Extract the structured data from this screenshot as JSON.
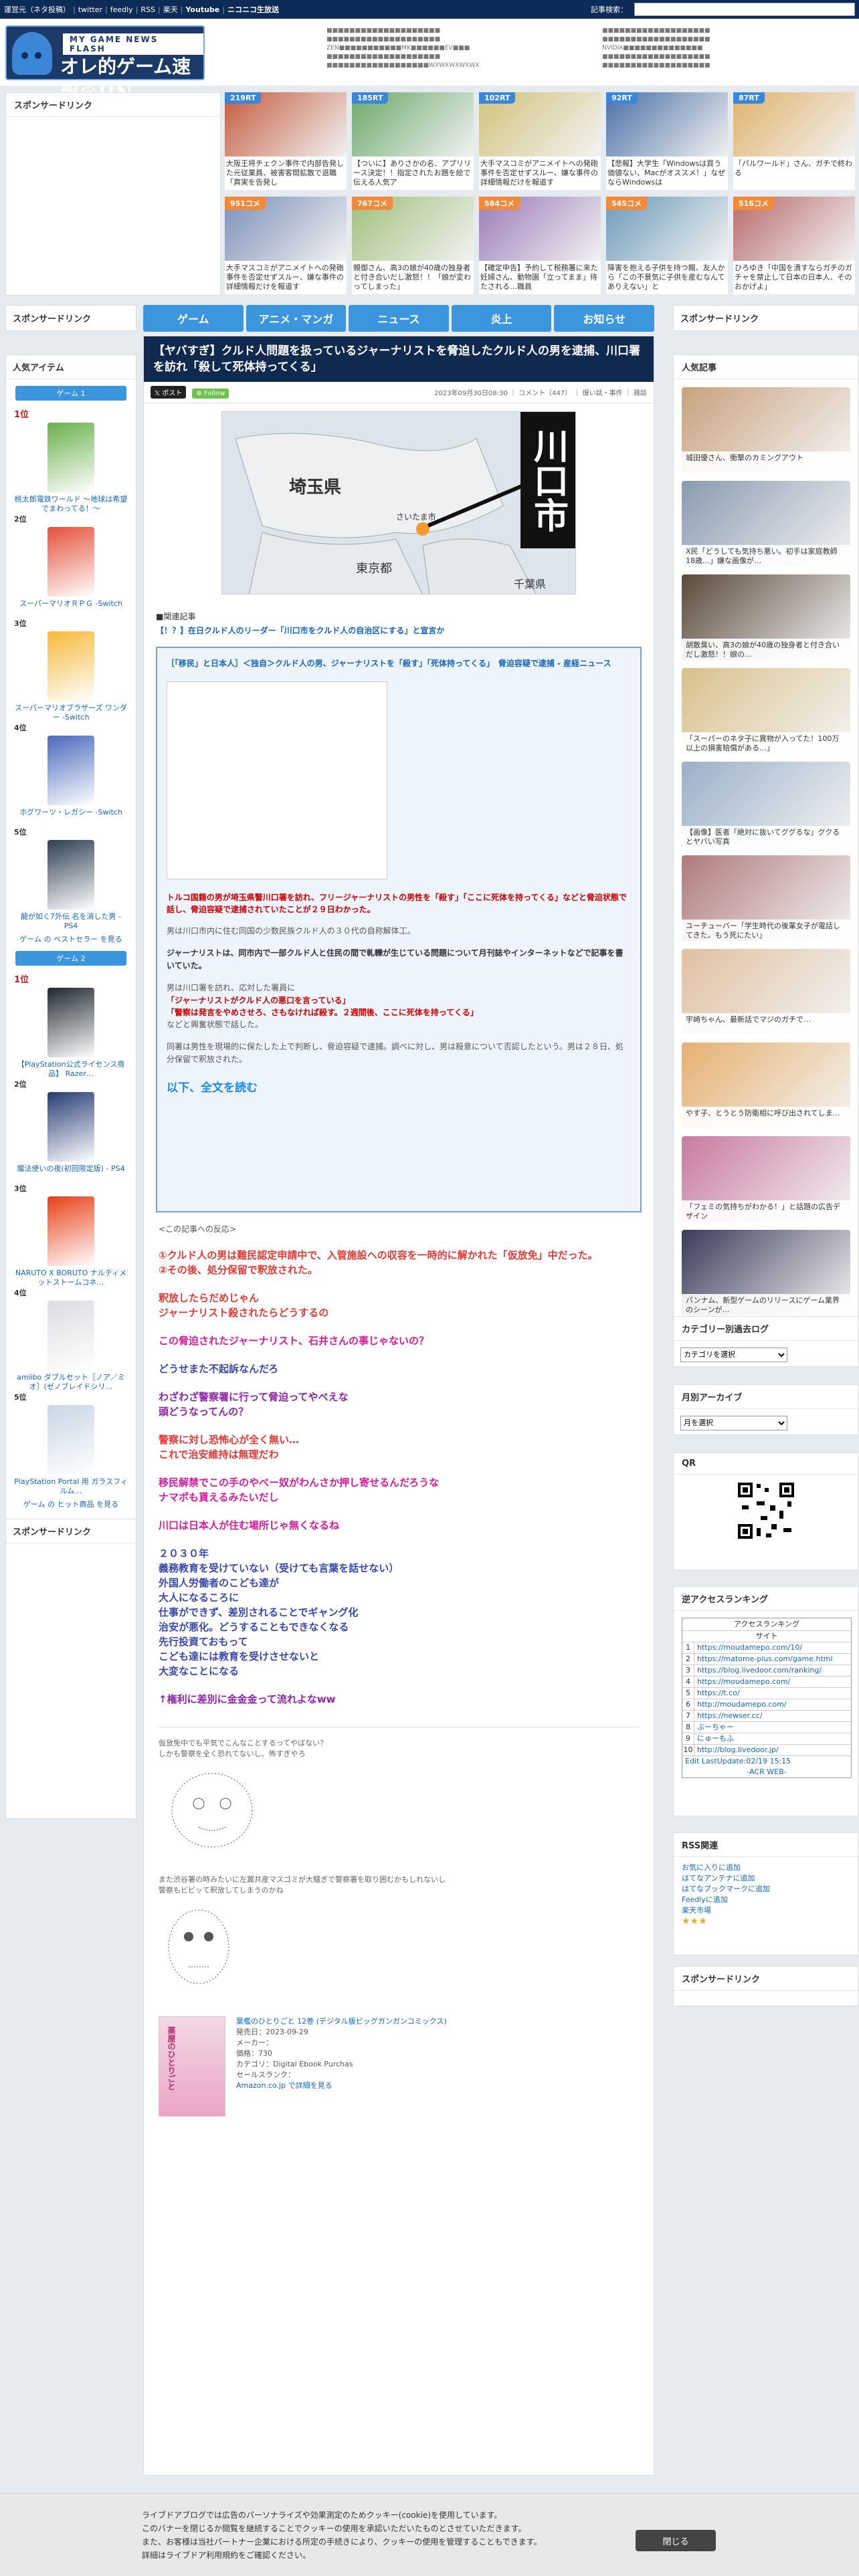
{
  "topbar": {
    "links": [
      "運営元（ネタ投稿）",
      "twitter",
      "feedly",
      "RSS",
      "楽天",
      "Youtube",
      "ニコニコ生放送"
    ],
    "search_label": "記事検索："
  },
  "logo": {
    "small": "MY GAME NEWS FLASH",
    "big": "オレ的ゲーム速報@JIN"
  },
  "header_ads": [
    [
      "■■■■■■■■■■■■■■■■■■■■",
      "■■■■■■■■■■■■■■■■■■■■",
      "ZEN■■■■■■■■■■■MK■■■■■■EV■■■",
      "■■■■■■■■■■■■■■■■■■■■",
      "■■■■■■■■■■■■■■■■■■WXWXWXWXWX"
    ],
    [
      "■■■■■■■■■■■■■■■■■■■",
      "■■■■■■■■■■■■■■■■■■■",
      "NVIDIA■■■■■■■■■■■■■■",
      "■■■■■■■■■■■■■■■■■■■",
      "■■■■■■■■■■■■■■■■■■■"
    ]
  ],
  "sponsor_title": "スポンサードリンク",
  "grid": [
    {
      "badge": "219RT",
      "orange": false,
      "cap": "大阪王将チェクン事件で内部告発した元従業員、被害客間拡散で退職「真実を告発し"
    },
    {
      "badge": "185RT",
      "orange": false,
      "cap": "【ついに】ありさかの名、アプリリース決定！！指定されたお題を絵で伝える人気ア"
    },
    {
      "badge": "102RT",
      "orange": false,
      "cap": "大手マスコミがアニメイトへの発砲事件を否定せずスルー、嫌な事件の詳細情報だけを報道す"
    },
    {
      "badge": "92RT",
      "orange": false,
      "cap": "【悲報】大学生「Windowsは買う価値ない、Macがオススメ！」なぜならWindowsは"
    },
    {
      "badge": "87RT",
      "orange": false,
      "cap": "「パルワールド」さん、ガチで終わる"
    },
    {
      "badge": "951コメ",
      "orange": true,
      "cap": "大手マスコミがアニメイトへの発砲事件を否定せずスルー、嫌な事件の詳細情報だけを報道す"
    },
    {
      "badge": "767コメ",
      "orange": true,
      "cap": "親御さん、高3の娘が40歳の独身者と付き合いだし激怒！！「娘が変わってしまった」"
    },
    {
      "badge": "584コメ",
      "orange": true,
      "cap": "【確定申告】予約して税務署に来た妊婦さん、動物園「立ってまま」待たされる…職員"
    },
    {
      "badge": "545コメ",
      "orange": true,
      "cap": "障害を抱える子供を持つ親、友人から「この不景気に子供を産むなんてありえない」と"
    },
    {
      "badge": "516コメ",
      "orange": true,
      "cap": "ひろゆき「中国を潰すならガチのガチャを禁止して日本の日本人、そのおかげよ」"
    }
  ],
  "nav": [
    "ゲーム",
    "アニメ・マンガ",
    "ニュース",
    "炎上",
    "お知らせ"
  ],
  "left": {
    "sponsor": "スポンサードリンク",
    "popular": "人気アイテム",
    "tab1": "ゲーム 1",
    "tab2": "ゲーム 2",
    "items1": [
      {
        "rank": "1位",
        "name": "桃太郎電鉄ワールド ～地球は希望でまわってる！～"
      },
      {
        "rank": "2位",
        "name": "スーパーマリオＲＰＧ -Switch"
      },
      {
        "rank": "3位",
        "name": "スーパーマリオブラザーズ ワンダー -Switch"
      },
      {
        "rank": "4位",
        "name": "ホグワーツ・レガシー -Switch"
      },
      {
        "rank": "5位",
        "name": "龍が如く7外伝 名を消した男 - PS4"
      }
    ],
    "more1": "ゲーム の ベストセラー を見る",
    "items2": [
      {
        "rank": "1位",
        "name": "【PlayStation公式ライセンス商品】 Razer…"
      },
      {
        "rank": "2位",
        "name": "魔法使いの夜(初回限定版) - PS4"
      },
      {
        "rank": "3位",
        "name": "NARUTO X BORUTO ナルティメットストームコネ…"
      },
      {
        "rank": "4位",
        "name": "amiibo ダブルセット［ノア／ミオ］(ゼノブレイドシリ…"
      },
      {
        "rank": "5位",
        "name": "PlayStation Portal 用 ガラスフィルム…"
      }
    ],
    "more2": "ゲーム の ヒット商品 を見る",
    "sponsor2": "スポンサードリンク"
  },
  "article": {
    "title": "【ヤバすぎ】クルド人問題を扱っているジャーナリストを脅迫したクルド人の男を逮捕、川口署を訪れ「殺して死体持ってくる」",
    "tweet": "ポスト",
    "follow": "Follow",
    "meta": "2023年09月30日08:30 ｜ コメント（447） ｜ 爆い話・事件 ｜ 雑談",
    "map_pref": "埼玉県",
    "map_city": "さいたま市",
    "map_tokyo": "東京都",
    "map_chiba": "千葉県",
    "map_callout": "川口市",
    "related_head": "■関連記事",
    "related_link": "【！？】在日クルド人のリーダー「川口市をクルド人の自治区にする」と宣言か",
    "quote_link": "［「移民」と日本人］＜独自＞クルド人の男、ジャーナリストを「殺す」「死体持ってくる」　脅迫容疑で逮捕 - 産経ニュース",
    "q1": "トルコ国籍の男が埼玉県警川口署を訪れ、フリージャーナリストの男性を「殺す」「ここに死体を持ってくる」などと脅迫状態で話し、脅迫容疑で逮捕されていたことが２９日わかった。",
    "q2": "男は川口市内に住む同国の少数民族クルド人の３０代の自称解体工。",
    "q3": "ジャーナリストは、同市内で一部クルド人と住民の間で軋轢が生じている問題について月刊誌やインターネットなどで記事を書いていた。",
    "q4": "男は川口署を訪れ、応対した署員に",
    "q5": "「ジャーナリストがクルド人の悪口を言っている」",
    "q6": "「警察は発言をやめさせろ、さもなければ殺す。２週間後、ここに死体を持ってくる」",
    "q7": "などと興奮状態で話した。",
    "q8": "同署は男性を現場的に保たした上で判断し、脅迫容疑で逮捕。調べに対し、男は殺意について否認したという。男は２８日、処分保留で釈放された。",
    "more": "以下、全文を読む",
    "react_head": "<この記事への反応>",
    "comments": [
      {
        "cls": "r",
        "text": "①クルド人の男は難民認定申請中で、入管施設への収容を一時的に解かれた「仮放免」中だった。\n②その後、処分保留で釈放された。"
      },
      {
        "cls": "r",
        "text": "釈放したらだめじゃん\nジャーナリスト殺されたらどうするの"
      },
      {
        "cls": "m",
        "text": "この脅迫されたジャーナリスト、石井さんの事じゃないの？"
      },
      {
        "cls": "b",
        "text": "どうせまた不起訴なんだろ"
      },
      {
        "cls": "p",
        "text": "わざわざ警察署に行って脅迫ってやべえな\n頭どうなってんの？"
      },
      {
        "cls": "r",
        "text": "警察に対し恐怖心が全く無い…\nこれで治安維持は無理だわ"
      },
      {
        "cls": "m",
        "text": "移民解禁でこの手のやべー奴がわんさか押し寄せるんだろうな\nナマポも貰えるみたいだし"
      },
      {
        "cls": "m",
        "text": "川口は日本人が住む場所じゃ無くなるね"
      },
      {
        "cls": "b",
        "text": "２０３０年\n義務教育を受けていない（受けても言葉を話せない）\n外国人労働者のこども達が\n大人になるころに\n仕事ができず、差別されることでギャング化\n治安が悪化。どうすることもできなくなる\n先行投資ておもって\nこども達には教育を受けさせないと\n大変なことになる"
      },
      {
        "cls": "p",
        "text": "↑権利に差別に金金金って流れよなww"
      }
    ],
    "aa1": "仮放免中でも平気でこんなことするってやばない？\nしかも警察を全く恐れてないし、怖すぎやろ",
    "aa2": "また渋谷署の時みたいに左翼共産マスゴミが大騒ぎで警察署を取り囲むかもしれないし\n警察もビビッて釈放してしまうのかね",
    "product": {
      "title": "葉檻のひとりごと 12巻 (デジタル版ビッグガンガンコミックス)",
      "lines": [
        "発売日：2023-09-29",
        "メーカー：",
        "価格：730",
        "カテゴリ：Digital Ebook Purchas",
        "セールスランク："
      ],
      "link": "Amazon.co.jp で詳細を見る",
      "cover_text": "薬屋のひとりごと"
    }
  },
  "right": {
    "sponsor": "スポンサードリンク",
    "popular": "人気記事",
    "items": [
      "城田優さん、衝撃のカミングアウト",
      "X民「どうしても気持ち悪い。初手は家庭教師18歳…」嫌な画像が…",
      "胡散臭い、高3の娘が40歳の独身者と付き合いだし激怒！！娘の…",
      "「スーパーのネタ子に異物が入ってた！100万以上の損害賠償がある…」",
      "【画像】医者「絶対に抜いてググるな」グクるとヤバい写真",
      "ユーチューバー「学生時代の後輩女子が電話してきた。もう死にたい」",
      "宇崎ちゃん、最新話でマジのガチで…",
      "やす子、とうとう防衛相に呼び出されてしま…",
      "「フェミの気持ちがわかる！」と話題の広告デザイン",
      "バンナム、新型ゲームのリリースにゲーム業界のシーンが…"
    ],
    "category_title": "カテゴリー別過去ログ",
    "category_select": "カテゴリを選択",
    "archive_title": "月別アーカイブ",
    "archive_select": "月を選択",
    "qr_title": "QR",
    "ranking_title": "逆アクセスランキング",
    "ranking_head": "アクセスランキング",
    "ranking_sub": "サイト",
    "ranking": [
      {
        "n": "1",
        "u": "https://moudamepo.com/10/"
      },
      {
        "n": "2",
        "u": "https://matome-plus.com/game.html"
      },
      {
        "n": "3",
        "u": "https://blog.livedoor.com/ranking/"
      },
      {
        "n": "4",
        "u": "https://moudamepo.com/"
      },
      {
        "n": "5",
        "u": "https://t.co/"
      },
      {
        "n": "6",
        "u": "http://moudamepo.com/"
      },
      {
        "n": "7",
        "u": "https://newser.cc/"
      },
      {
        "n": "8",
        "u": "ぶーちゃー"
      },
      {
        "n": "9",
        "u": "にゅーもふ"
      },
      {
        "n": "10",
        "u": "http://blog.livedoor.jp/"
      }
    ],
    "ranking_foot": "Edit LastUpdate:02/19 15:15",
    "ranking_web": "-ACR WEB-",
    "rss_title": "RSS関連",
    "rss": [
      "お気に入りに追加",
      "はてなアンテナに追加",
      "はてなブックマークに追加",
      "Feedlyに追加",
      "楽天市場"
    ],
    "sponsor2": "スポンサードリンク"
  },
  "cookie": {
    "l1": "ライブドアブログでは広告のパーソナライズや効果測定のためクッキー(cookie)を使用しています。",
    "l2": "このバナーを閉じるか閲覧を継続することでクッキーの使用を承認いただいたものとさせていただきます。",
    "l3": "また、お客様は当社パートナー企業における所定の手続きにより、クッキーの使用を管理することもできます。",
    "l4": "詳細はライブドア利用規約をご確認ください。",
    "close": "閉じる"
  },
  "colors": {
    "nav": "#3b96de",
    "header": "#0d2b57",
    "title_bg": "#10294f"
  }
}
